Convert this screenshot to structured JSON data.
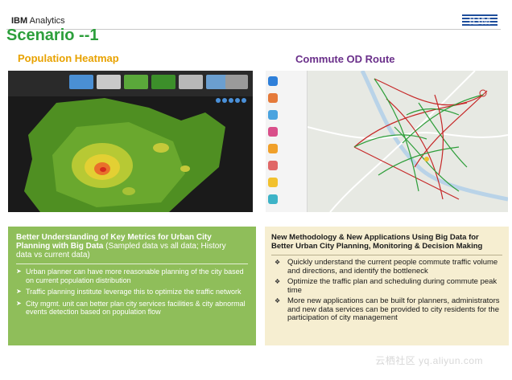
{
  "header": {
    "brand_prefix": "IBM",
    "brand_suffix": "Analytics",
    "logo_text": "IBM",
    "title": "Scenario --1"
  },
  "sections": {
    "left_title": "Population Heatmap",
    "right_title": "Commute OD Route"
  },
  "heatmap": {
    "tabs": [
      "",
      "",
      "",
      "",
      "",
      "",
      ""
    ],
    "colors": [
      "#4a8fd4",
      "#c9c9c9",
      "#5aa83a",
      "#3c8f2a",
      "#b8b8b8",
      "#6b9fd0",
      "#9a9a9a"
    ]
  },
  "od_panel": {
    "items": [
      {
        "label": "",
        "color": "#2e7fd9"
      },
      {
        "label": "",
        "color": "#e57a3a"
      },
      {
        "label": "",
        "color": "#4aa3df"
      },
      {
        "label": "",
        "color": "#d94f8a"
      },
      {
        "label": "",
        "color": "#f0a02a"
      },
      {
        "label": "",
        "color": "#e06767"
      },
      {
        "label": "",
        "color": "#f2c12e"
      },
      {
        "label": "",
        "color": "#3db3c7"
      }
    ],
    "city_tags": [
      "",
      "",
      "",
      "",
      "",
      "",
      "",
      "",
      "",
      "",
      "",
      "",
      ""
    ]
  },
  "left_box": {
    "heading_bold": "Better Understanding of Key Metrics for Urban City Planning with Big Data",
    "heading_normal": " (Sampled data vs all data; History data vs current data)",
    "bullets": [
      "Urban planner can have more reasonable planning of the city based on current population distribution",
      "Traffic planning institute leverage this to optimize the traffic network",
      "City mgmt. unit can better plan city services facilities & city abnormal events detection based on population flow"
    ]
  },
  "right_box": {
    "heading": "New Methodology & New Applications Using Big Data for Better Urban City Planning, Monitoring & Decision Making",
    "bullets": [
      "Quickly understand the current people commute traffic volume and directions, and identify the bottleneck",
      "Optimize the traffic plan and scheduling during commute peak time",
      "More new applications can be built for planners, administrators and new data services can be provided to city residents for the participation of city management"
    ]
  },
  "watermark": "云栖社区 yq.aliyun.com"
}
